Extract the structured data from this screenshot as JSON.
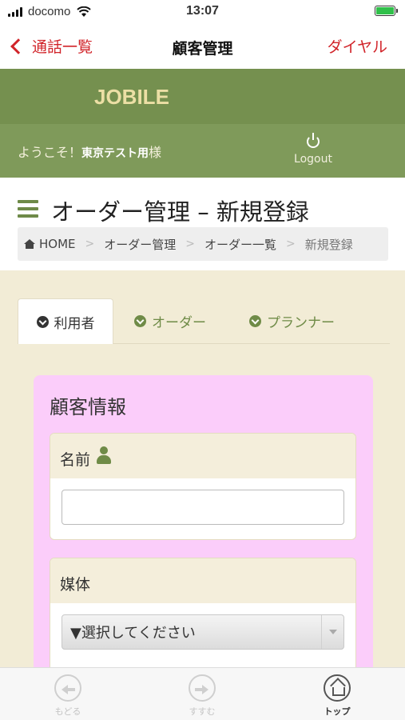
{
  "status_bar": {
    "carrier": "docomo",
    "time": "13:07"
  },
  "nav_bar": {
    "back_label": "通話一覧",
    "title": "顧客管理",
    "right_label": "ダイヤル"
  },
  "site": {
    "brand": "JOBILE",
    "welcome_prefix": "ようこそ！",
    "user_name": "東京テスト用",
    "welcome_suffix": "様",
    "logout_label": "Logout"
  },
  "page": {
    "title": "オーダー管理 – 新規登録",
    "breadcrumb": [
      "HOME",
      "オーダー管理",
      "オーダー一覧",
      "新規登録"
    ]
  },
  "tabs": [
    "利用者",
    "オーダー",
    "プランナー"
  ],
  "card": {
    "title": "顧客情報",
    "fields": {
      "name_label": "名前",
      "name_value": "",
      "media_label": "媒体",
      "media_selected": "▼選択してください"
    }
  },
  "toolbar": {
    "back_label": "もどる",
    "forward_label": "すすむ",
    "top_label": "トップ"
  },
  "colors": {
    "nav_accent": "#d1242a",
    "brand_green": "#75904f",
    "card_pink": "#fbcdfa"
  }
}
